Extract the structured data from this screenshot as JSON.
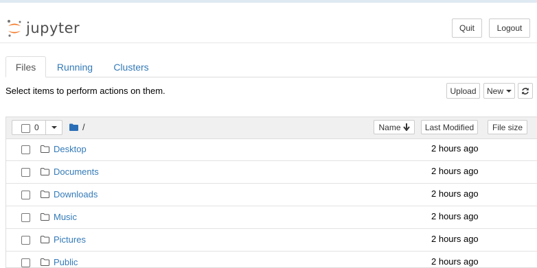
{
  "header": {
    "logo_text": "jupyter",
    "quit_label": "Quit",
    "logout_label": "Logout",
    "logo_colors": {
      "orange": "#f37726",
      "gray": "#767677"
    }
  },
  "tabs": [
    {
      "label": "Files",
      "active": true
    },
    {
      "label": "Running",
      "active": false
    },
    {
      "label": "Clusters",
      "active": false
    }
  ],
  "toolbar": {
    "instructions": "Select items to perform actions on them.",
    "upload_label": "Upload",
    "new_label": "New",
    "refresh_icon": "refresh-icon"
  },
  "list": {
    "selected_count": "0",
    "breadcrumb": "/",
    "columns": {
      "name": "Name",
      "last_modified": "Last Modified",
      "file_size": "File size"
    },
    "items": [
      {
        "name": "Desktop",
        "modified": "2 hours ago"
      },
      {
        "name": "Documents",
        "modified": "2 hours ago"
      },
      {
        "name": "Downloads",
        "modified": "2 hours ago"
      },
      {
        "name": "Music",
        "modified": "2 hours ago"
      },
      {
        "name": "Pictures",
        "modified": "2 hours ago"
      },
      {
        "name": "Public",
        "modified": "2 hours ago"
      }
    ]
  },
  "colors": {
    "link": "#337ab7",
    "folder_blue": "#2a6eb7",
    "header_bg": "#f0f0f0"
  }
}
